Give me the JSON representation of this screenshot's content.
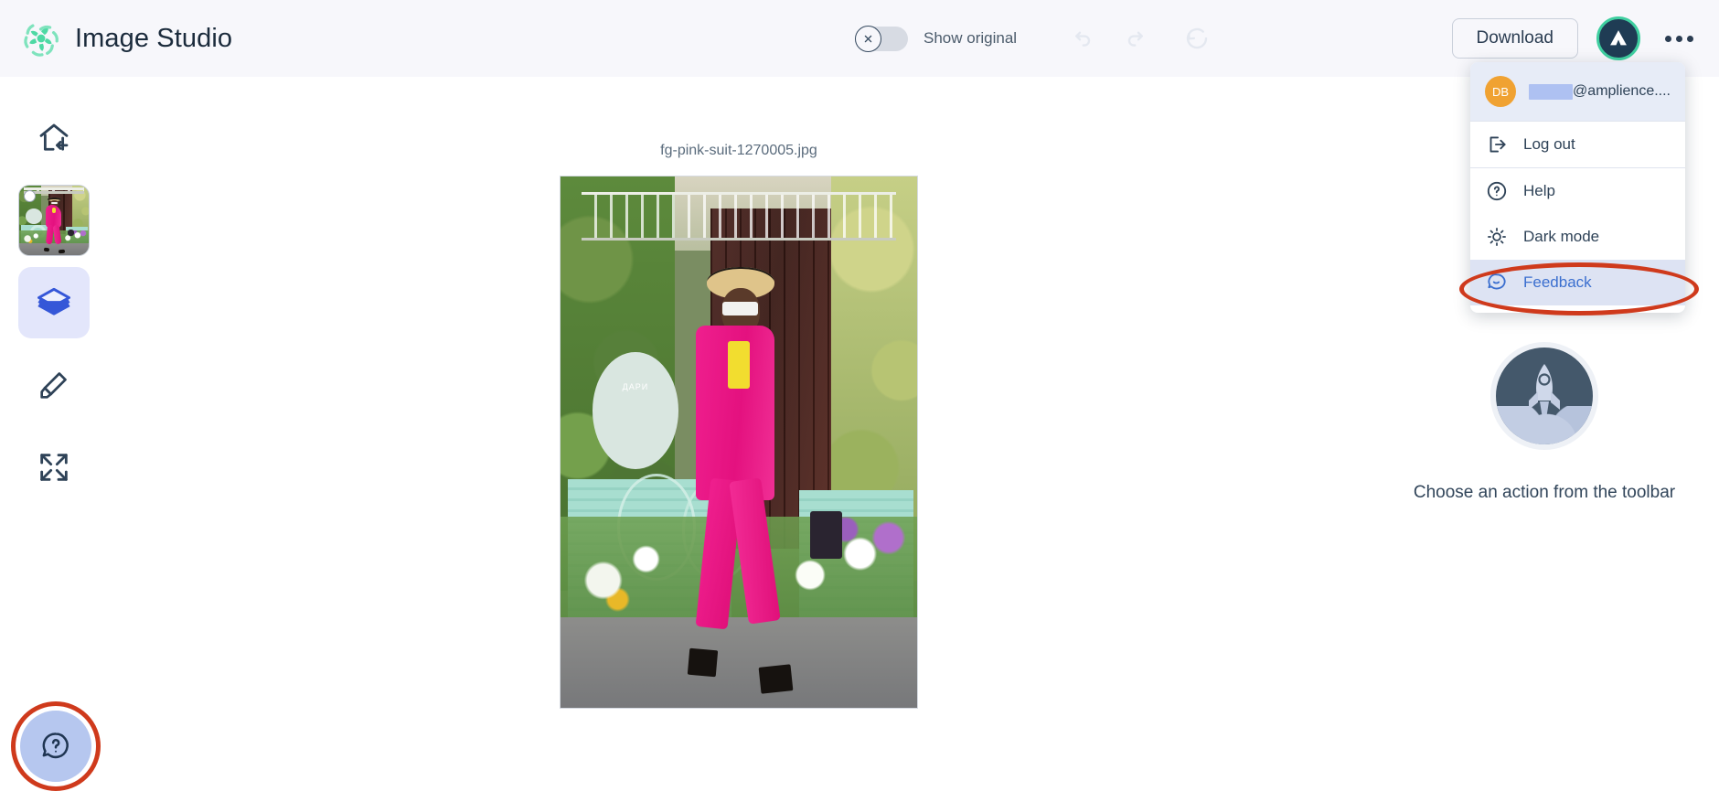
{
  "app": {
    "title": "Image Studio",
    "logo_icon": "pinwheel-logo-icon",
    "accent_green": "#4ed9a4",
    "header_bg": "#f7f7fb"
  },
  "toolbar": {
    "show_original_label": "Show original",
    "show_original_state": "off",
    "toggle_knob_icon": "close-circle-icon",
    "undo_icon": "undo-arrow-icon",
    "redo_icon": "redo-arrow-icon",
    "reset_icon": "reset-circular-arrow-icon",
    "download_label": "Download",
    "avatar_icon": "amplience-logo-icon",
    "overflow_icon": "ellipsis-icon"
  },
  "sidebar": {
    "items": [
      {
        "name": "home",
        "icon": "home-with-arrow-icon",
        "active": false
      },
      {
        "name": "image-thumbnail",
        "icon": "image-thumbnail",
        "active": true
      },
      {
        "name": "layers",
        "icon": "layers-icon",
        "active": true
      },
      {
        "name": "eraser",
        "icon": "eraser-icon",
        "active": false
      },
      {
        "name": "expand",
        "icon": "expand-arrows-icon",
        "active": false
      }
    ]
  },
  "canvas": {
    "filename": "fg-pink-suit-1270005.jpg",
    "image_alt": "Woman in pink suit and straw hat walking past a mint green flower stand",
    "sign_text": "ДАРИ"
  },
  "right_panel": {
    "illustration_icon": "rocket-launch-icon",
    "empty_message": "Choose an action from the toolbar"
  },
  "help_fab": {
    "icon": "question-speech-bubble-icon",
    "annotation": "red-circle-highlight"
  },
  "account_menu": {
    "avatar_initials": "DB",
    "email_redacted": true,
    "email_suffix": "@amplience....",
    "items": [
      {
        "label": "Log out",
        "icon": "logout-icon",
        "highlighted": false
      },
      {
        "label": "Help",
        "icon": "question-circle-icon",
        "highlighted": false
      },
      {
        "label": "Dark mode",
        "icon": "sun-icon",
        "highlighted": false
      },
      {
        "label": "Feedback",
        "icon": "speech-bubble-smile-icon",
        "highlighted": true
      }
    ],
    "annotation": "red-ellipse-highlight",
    "annotation_color": "#cf3a1c",
    "highlight_color": "#3b6fcf"
  }
}
